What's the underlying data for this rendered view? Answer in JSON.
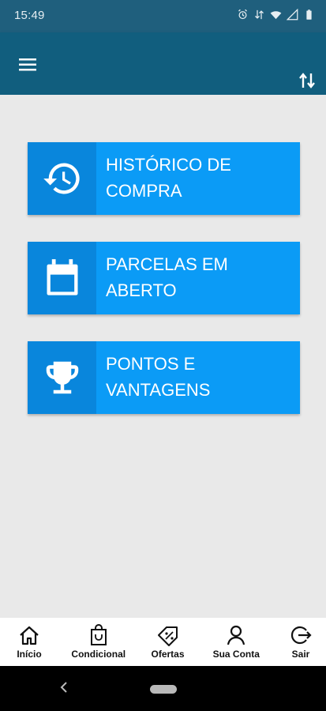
{
  "status_bar": {
    "time": "15:49",
    "icons": [
      "alarm-icon",
      "data-arrows-icon",
      "wifi-icon",
      "signal-icon",
      "battery-icon"
    ]
  },
  "app_bar": {
    "menu_icon": "hamburger-menu-icon",
    "action_icon": "swap-vertical-icon",
    "color": "#115e7e"
  },
  "cards": [
    {
      "icon": "history-icon",
      "label": "HISTÓRICO DE COMPRA"
    },
    {
      "icon": "calendar-icon",
      "label": "PARCELAS EM ABERTO"
    },
    {
      "icon": "trophy-icon",
      "label": "PONTOS E VANTAGENS"
    }
  ],
  "card_colors": {
    "background": "#0b9bf6",
    "icon_box": "#0986dc"
  },
  "bottom_nav": {
    "items": [
      {
        "icon": "home-icon",
        "label": "Início"
      },
      {
        "icon": "shopping-bag-icon",
        "label": "Condicional"
      },
      {
        "icon": "tag-percent-icon",
        "label": "Ofertas"
      },
      {
        "icon": "user-icon",
        "label": "Sua Conta"
      },
      {
        "icon": "logout-icon",
        "label": "Sair"
      }
    ]
  }
}
